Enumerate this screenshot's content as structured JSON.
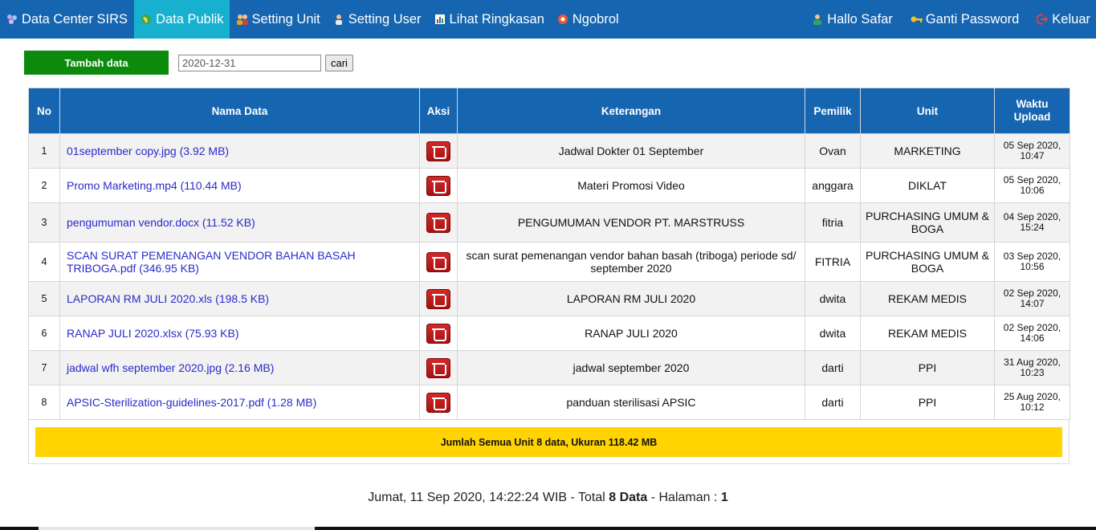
{
  "nav": {
    "left": [
      {
        "label": "Data Center SIRS",
        "icon": "sirs-logo-icon"
      },
      {
        "label": "Data Publik",
        "icon": "globe-icon",
        "active": true
      },
      {
        "label": "Setting Unit",
        "icon": "users-icon"
      },
      {
        "label": "Setting User",
        "icon": "user-icon"
      },
      {
        "label": "Lihat Ringkasan",
        "icon": "report-icon"
      },
      {
        "label": "Ngobrol",
        "icon": "chat-icon"
      }
    ],
    "right": [
      {
        "label": "Hallo Safar",
        "icon": "user-admin-icon"
      },
      {
        "label": "Ganti Password",
        "icon": "key-icon"
      },
      {
        "label": "Keluar",
        "icon": "logout-icon"
      }
    ]
  },
  "toolbar": {
    "add_label": "Tambah data",
    "date_value": "2020-12-31",
    "search_label": "cari"
  },
  "table": {
    "headers": {
      "no": "No",
      "nama": "Nama Data",
      "aksi": "Aksi",
      "keterangan": "Keterangan",
      "pemilik": "Pemilik",
      "unit": "Unit",
      "waktu_1": "Waktu",
      "waktu_2": "Upload"
    },
    "rows": [
      {
        "no": "1",
        "nama": "01september copy.jpg (3.92 MB)",
        "keterangan": "Jadwal Dokter 01 September",
        "pemilik": "Ovan",
        "unit": "MARKETING",
        "tanggal": "05 Sep 2020,",
        "jam": "10:47"
      },
      {
        "no": "2",
        "nama": "Promo Marketing.mp4 (110.44 MB)",
        "keterangan": "Materi Promosi Video",
        "pemilik": "anggara",
        "unit": "DIKLAT",
        "tanggal": "05 Sep 2020,",
        "jam": "10:06"
      },
      {
        "no": "3",
        "nama": "pengumuman vendor.docx (11.52 KB)",
        "keterangan": "PENGUMUMAN VENDOR PT. MARSTRUSS",
        "pemilik": "fitria",
        "unit": "PURCHASING UMUM & BOGA",
        "tanggal": "04 Sep 2020,",
        "jam": "15:24"
      },
      {
        "no": "4",
        "nama": "SCAN SURAT PEMENANGAN VENDOR BAHAN BASAH TRIBOGA.pdf (346.95 KB)",
        "keterangan": "scan surat pemenangan vendor bahan basah (triboga) periode sd/ september 2020",
        "pemilik": "FITRIA",
        "unit": "PURCHASING UMUM & BOGA",
        "tanggal": "03 Sep 2020,",
        "jam": "10:56"
      },
      {
        "no": "5",
        "nama": "LAPORAN RM JULI 2020.xls (198.5 KB)",
        "keterangan": "LAPORAN RM JULI 2020",
        "pemilik": "dwita",
        "unit": "REKAM MEDIS",
        "tanggal": "02 Sep 2020,",
        "jam": "14:07"
      },
      {
        "no": "6",
        "nama": "RANAP JULI 2020.xlsx (75.93 KB)",
        "keterangan": "RANAP JULI 2020",
        "pemilik": "dwita",
        "unit": "REKAM MEDIS",
        "tanggal": "02 Sep 2020,",
        "jam": "14:06"
      },
      {
        "no": "7",
        "nama": "jadwal wfh september 2020.jpg (2.16 MB)",
        "keterangan": "jadwal september 2020",
        "pemilik": "darti",
        "unit": "PPI",
        "tanggal": "31 Aug 2020,",
        "jam": "10:23"
      },
      {
        "no": "8",
        "nama": "APSIC-Sterilization-guidelines-2017.pdf (1.28 MB)",
        "keterangan": "panduan sterilisasi APSIC",
        "pemilik": "darti",
        "unit": "PPI",
        "tanggal": "25 Aug 2020,",
        "jam": "10:12"
      }
    ],
    "delete_icon": "trash-icon"
  },
  "summary": "Jumlah Semua Unit 8 data, Ukuran 118.42 MB",
  "footer": {
    "prefix": "Jumat, 11 Sep 2020, 14:22:24 WIB - Total ",
    "total": "8 Data",
    "middle": " - Halaman : ",
    "page": "1"
  },
  "colors": {
    "nav_bg": "#1565b0",
    "nav_active": "#18b0cf",
    "add_button": "#0c8a0c",
    "summary_bg": "#ffd400",
    "link": "#2a2acc",
    "delete": "#c01818"
  }
}
